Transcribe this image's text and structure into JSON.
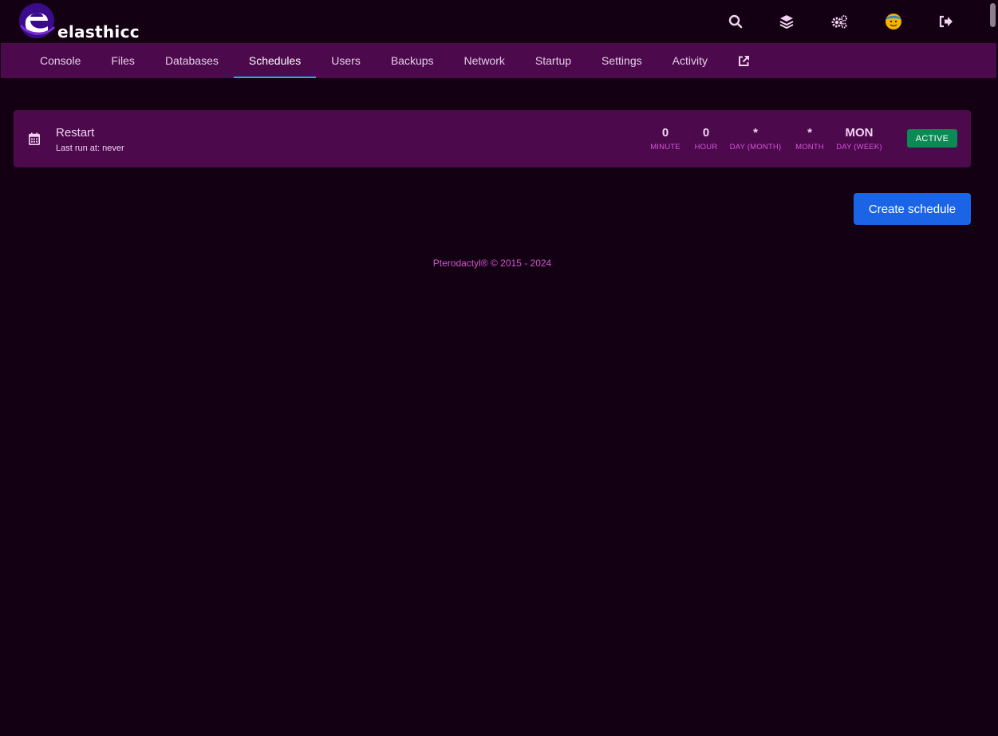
{
  "brand": {
    "name": "elasthicc"
  },
  "header": {
    "icons": [
      "search-icon",
      "layers-icon",
      "cogs-icon",
      "avatar",
      "sign-out-icon"
    ]
  },
  "nav": {
    "items": [
      {
        "label": "Console"
      },
      {
        "label": "Files"
      },
      {
        "label": "Databases"
      },
      {
        "label": "Schedules",
        "active": true
      },
      {
        "label": "Users"
      },
      {
        "label": "Backups"
      },
      {
        "label": "Network"
      },
      {
        "label": "Startup"
      },
      {
        "label": "Settings"
      },
      {
        "label": "Activity"
      }
    ],
    "external_icon": "external-link-icon"
  },
  "schedules": [
    {
      "name": "Restart",
      "last_run": "Last run at: never",
      "cron": {
        "minute": {
          "value": "0",
          "label": "MINUTE"
        },
        "hour": {
          "value": "0",
          "label": "HOUR"
        },
        "day_month": {
          "value": "*",
          "label": "DAY (MONTH)"
        },
        "month": {
          "value": "*",
          "label": "MONTH"
        },
        "day_week": {
          "value": "MON",
          "label": "DAY (WEEK)"
        }
      },
      "status": "ACTIVE"
    }
  ],
  "actions": {
    "create_label": "Create schedule"
  },
  "footer": {
    "text": "Pterodactyl® © 2015 - 2024"
  },
  "colors": {
    "background": "#130013",
    "nav": "#4c0a4d",
    "accent": "#d257d2",
    "active_underline": "#1bb3d4",
    "status_active": "#0c8a55",
    "primary_button": "#1c64e6"
  }
}
